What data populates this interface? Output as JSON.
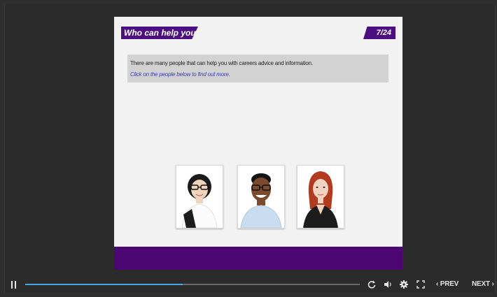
{
  "slide": {
    "title": "Who can help you?",
    "page": "7/24",
    "intro_text": "There are many people that can help you with careers advice and information.",
    "instruction_text": "Click on the people below to find out more."
  },
  "people": [
    {
      "label": "Woman with glasses",
      "skin": "#f0d5bd",
      "hair": "#1b1b1b",
      "clothes": "#fbfbfb"
    },
    {
      "label": "Man with glasses",
      "skin": "#7a4a2e",
      "hair": "#141414",
      "clothes": "#c9ddf0"
    },
    {
      "label": "Red-haired woman",
      "skin": "#f3d2c0",
      "hair": "#b23a1f",
      "clothes": "#1c1c1c"
    }
  ],
  "player": {
    "progress": 0.47,
    "prev_label": "PREV",
    "next_label": "NEXT"
  },
  "colors": {
    "accent_purple": "#4b0f7f",
    "footer_purple": "#4b0672",
    "progress_blue": "#4aa7e0",
    "player_bg": "#2e2e2e"
  }
}
